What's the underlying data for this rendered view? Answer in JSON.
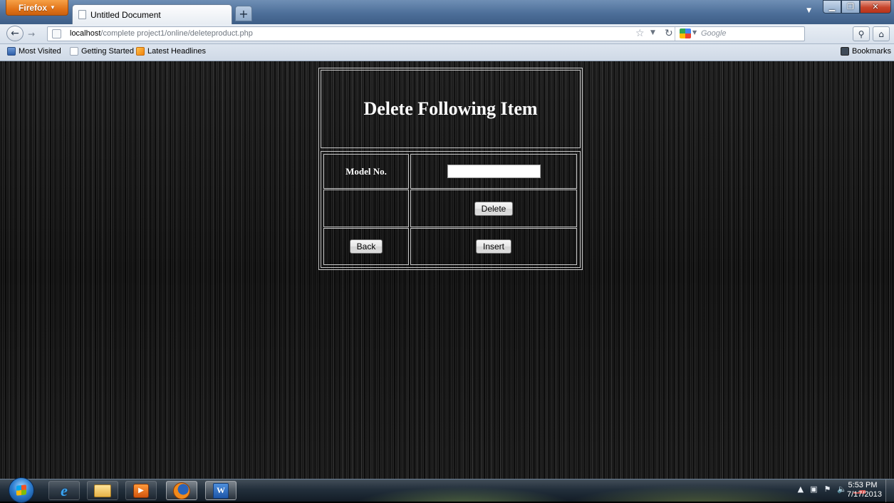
{
  "browser": {
    "menu_button_label": "Firefox",
    "tab_title": "Untitled Document",
    "new_tab_label": "+",
    "url_host": "localhost",
    "url_path": "/complete project1/online/deleteproduct.php",
    "search_placeholder": "Google",
    "bookmarks_toolbar": {
      "items": [
        "Most Visited",
        "Getting Started",
        "Latest Headlines"
      ],
      "bookmarks_menu_label": "Bookmarks"
    }
  },
  "page": {
    "heading": "Delete Following Item",
    "model_label": "Model No.",
    "model_input_value": "",
    "delete_button": "Delete",
    "back_button": "Back",
    "insert_button": "Insert"
  },
  "taskbar": {
    "apps": [
      "internet-explorer",
      "windows-explorer",
      "media-center",
      "firefox",
      "microsoft-word"
    ],
    "clock_time": "5:53 PM",
    "clock_date": "7/17/2013"
  },
  "colors": {
    "page_background": "#0a0a0a",
    "table_border": "#c9c9c9",
    "heading_text": "#ffffff",
    "firefox_button": "#e27419"
  }
}
